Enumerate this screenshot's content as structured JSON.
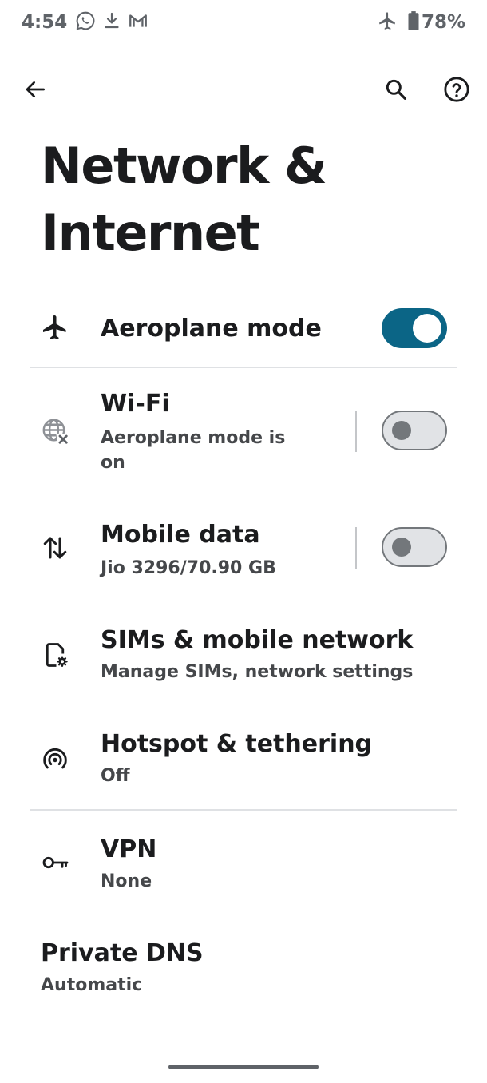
{
  "status_bar": {
    "time": "4:54",
    "battery": "78%",
    "battery_level": 0.78,
    "left_icons": [
      "whatsapp-icon",
      "download-icon",
      "gmail-icon"
    ],
    "right_icons": [
      "airplane-icon",
      "battery-icon"
    ]
  },
  "app_bar": {
    "back_icon": "arrow-back-icon",
    "search_icon": "search-icon",
    "help_icon": "help-icon"
  },
  "page": {
    "title_line1": "Network &",
    "title_line2": "Internet"
  },
  "items": {
    "aeroplane": {
      "title": "Aeroplane mode",
      "icon": "airplane-icon",
      "toggle": true
    },
    "wifi": {
      "title": "Wi-Fi",
      "sub_line1": "Aeroplane mode is",
      "sub_line2": "on",
      "icon": "globe-off-icon",
      "toggle": false
    },
    "mobile_data": {
      "title": "Mobile data",
      "sub": "Jio 3296/70.90 GB",
      "icon": "swap-vert-icon",
      "toggle": false
    },
    "sims": {
      "title": "SIMs & mobile network",
      "sub": "Manage SIMs, network settings",
      "icon": "sim-settings-icon"
    },
    "hotspot": {
      "title": "Hotspot & tethering",
      "sub": "Off",
      "icon": "hotspot-icon"
    },
    "vpn": {
      "title": "VPN",
      "sub": "None",
      "icon": "key-icon"
    },
    "private_dns": {
      "title": "Private DNS",
      "sub": "Automatic"
    }
  },
  "colors": {
    "accent": "#0b6586",
    "text_primary": "#1b1c1e",
    "text_secondary": "#45474a",
    "switch_off_track": "#e1e3e6",
    "switch_off_thumb": "#73777b"
  }
}
